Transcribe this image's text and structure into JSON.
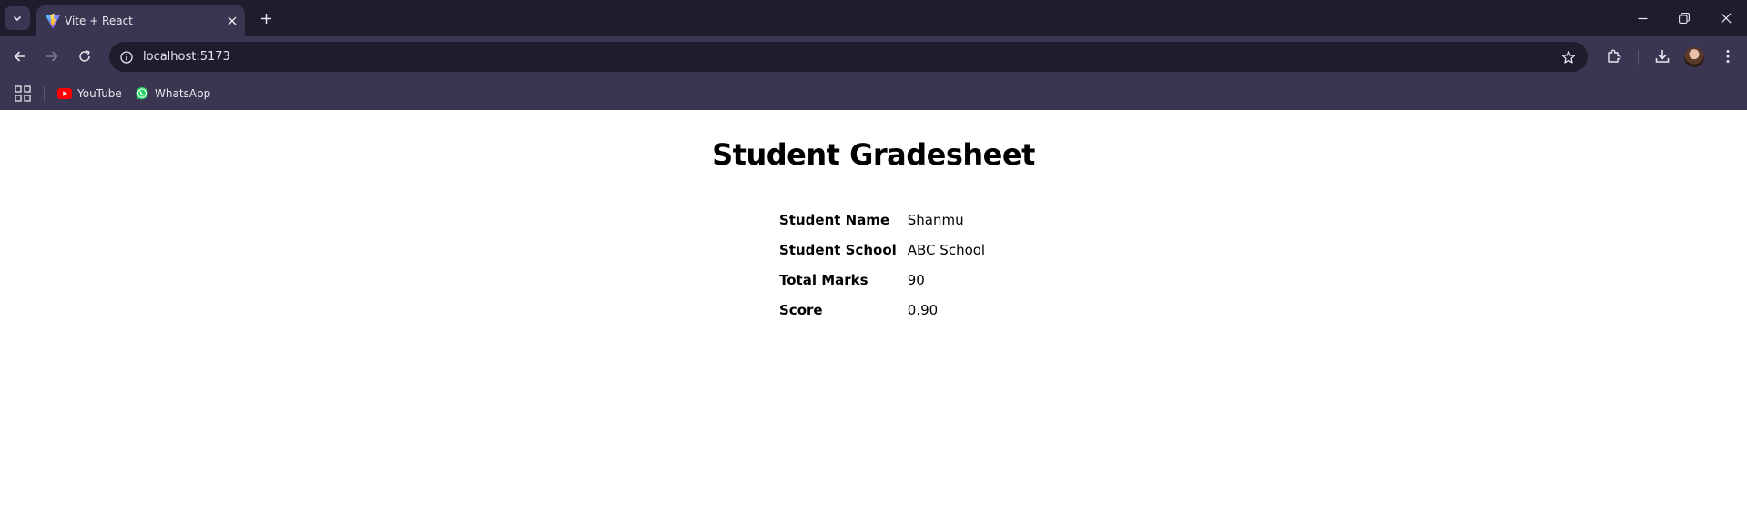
{
  "browser": {
    "tab": {
      "title": "Vite + React"
    },
    "address_bar": {
      "url": "localhost:5173"
    },
    "bookmarks": [
      {
        "label": "YouTube",
        "icon": "youtube-icon"
      },
      {
        "label": "WhatsApp",
        "icon": "whatsapp-icon"
      }
    ],
    "colors": {
      "tabstrip": "#201c2d",
      "toolbar": "#3a3550",
      "text": "#e8e6ef"
    }
  },
  "page": {
    "title": "Student Gradesheet",
    "rows": [
      {
        "label": "Student Name",
        "value": "Shanmu"
      },
      {
        "label": "Student School",
        "value": "ABC School"
      },
      {
        "label": "Total Marks",
        "value": "90"
      },
      {
        "label": "Score",
        "value": "0.90"
      }
    ]
  }
}
